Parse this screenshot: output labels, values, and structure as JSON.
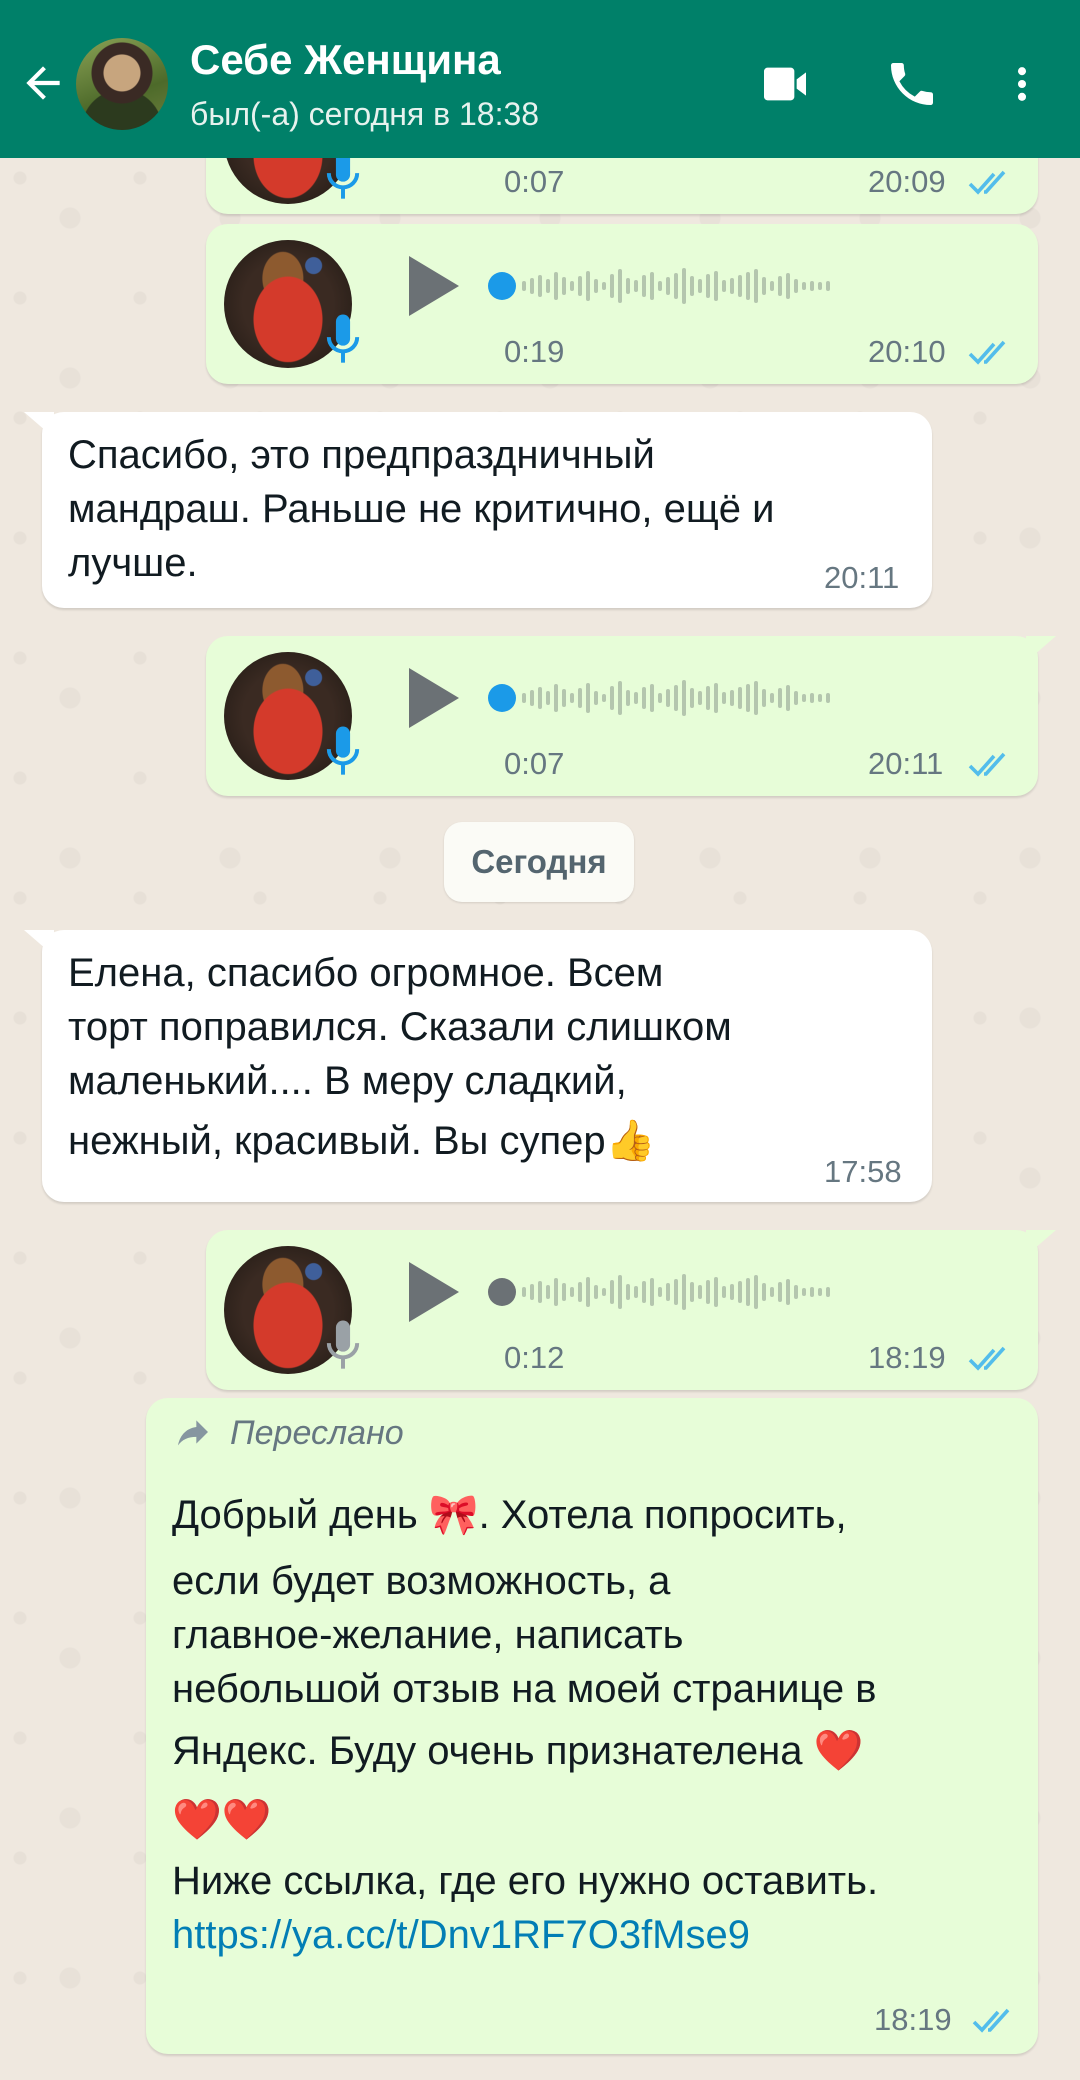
{
  "header": {
    "contact_name": "Себе Женщина",
    "status": "был(-а) сегодня в 18:38",
    "icons": [
      "back-arrow-icon",
      "video-call-icon",
      "phone-icon",
      "more-vert-icon"
    ],
    "color": "#008069"
  },
  "messages": [
    {
      "type": "voice",
      "direction": "out",
      "duration": "0:07",
      "time": "20:09"
    },
    {
      "type": "voice",
      "direction": "out",
      "duration": "0:19",
      "time": "20:10"
    },
    {
      "type": "text",
      "direction": "in",
      "lines": [
        "Спасибо, это предпраздничный",
        "мандраш. Раньше не критично, ещё и",
        "лучше."
      ],
      "time": "20:11"
    },
    {
      "type": "voice",
      "direction": "out",
      "duration": "0:07",
      "time": "20:11"
    },
    {
      "type": "text",
      "direction": "in",
      "lines": [
        "Елена, спасибо огромное. Всем",
        "торт поправился. Сказали слишком",
        "маленький.... В меру сладкий,",
        "нежный, красивый. Вы супер👍"
      ],
      "time": "17:58"
    },
    {
      "type": "voice",
      "direction": "out",
      "duration": "0:12",
      "time": "18:19",
      "played": false
    },
    {
      "type": "forwarded",
      "direction": "out",
      "forwarded_label": "Переслано",
      "lines": [
        "Добрый день 🎀.  Хотела попросить,",
        "если будет возможность,  а",
        "главное-желание,  написать",
        "небольшой отзыв на моей странице в",
        "Яндекс.  Буду очень признателена ❤️",
        "❤️❤️",
        "Ниже ссылка, где его нужно оставить."
      ],
      "link": " https://ya.cc/t/Dnv1RF7O3fMse9",
      "time": "18:19"
    }
  ],
  "date_divider": "Сегодня",
  "colors": {
    "outgoing_bubble": "#e7fdd8",
    "incoming_bubble": "#ffffff",
    "read_ticks": "#53bdeb"
  }
}
